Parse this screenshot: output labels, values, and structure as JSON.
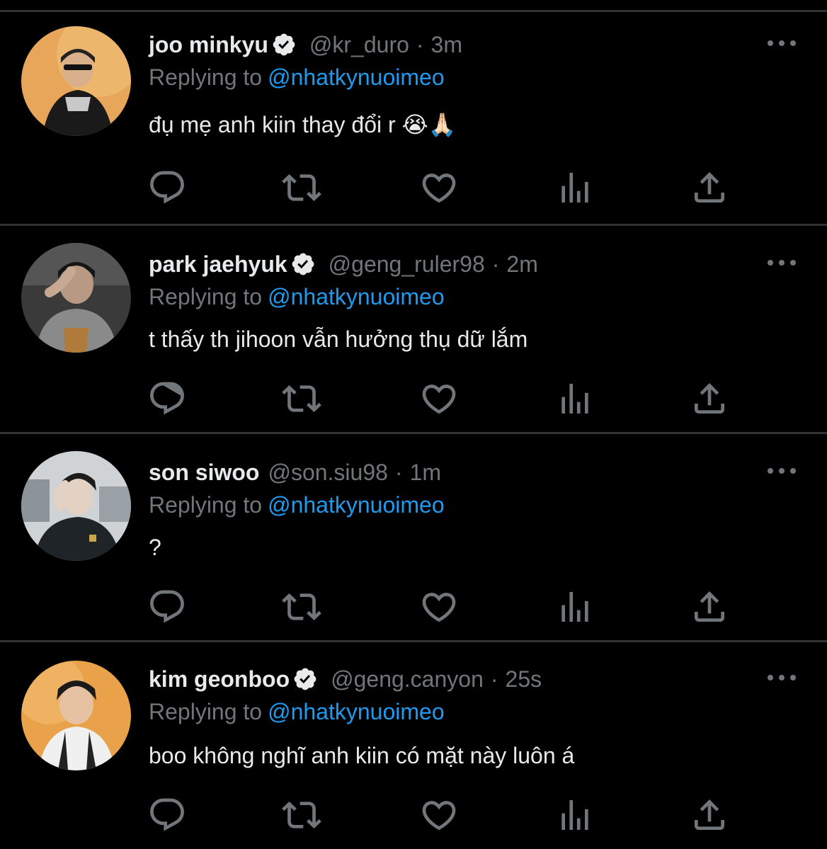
{
  "colors": {
    "background": "#000000",
    "text": "#e7e9ea",
    "muted": "#71767b",
    "link": "#1d9bf0",
    "divider": "#2f3336"
  },
  "tweets": [
    {
      "display_name": "joo minkyu",
      "verified": true,
      "handle": "@kr_duro",
      "dot": "·",
      "time": "3m",
      "reply_prefix": "Replying to",
      "reply_target": "@nhatkynuoimeo",
      "text": "đụ mẹ anh kiin thay đổi r 😭🙏🏻"
    },
    {
      "display_name": "park jaehyuk",
      "verified": true,
      "handle": "@geng_ruler98",
      "dot": "·",
      "time": "2m",
      "reply_prefix": "Replying to",
      "reply_target": "@nhatkynuoimeo",
      "text": "t thấy th jihoon vẫn hưởng thụ dữ lắm"
    },
    {
      "display_name": "son siwoo",
      "verified": false,
      "handle": "@son.siu98",
      "dot": "·",
      "time": "1m",
      "reply_prefix": "Replying to",
      "reply_target": "@nhatkynuoimeo",
      "text": "?"
    },
    {
      "display_name": "kim geonboo",
      "verified": true,
      "handle": "@geng.canyon",
      "dot": "·",
      "time": "25s",
      "reply_prefix": "Replying to",
      "reply_target": "@nhatkynuoimeo",
      "text": "boo không nghĩ anh kiin có mặt này luôn á"
    }
  ],
  "icons": {
    "reply": "reply-icon",
    "retweet": "retweet-icon",
    "like": "heart-icon",
    "views": "views-icon",
    "share": "share-icon",
    "more": "more-icon",
    "verified": "verified-badge-icon"
  }
}
